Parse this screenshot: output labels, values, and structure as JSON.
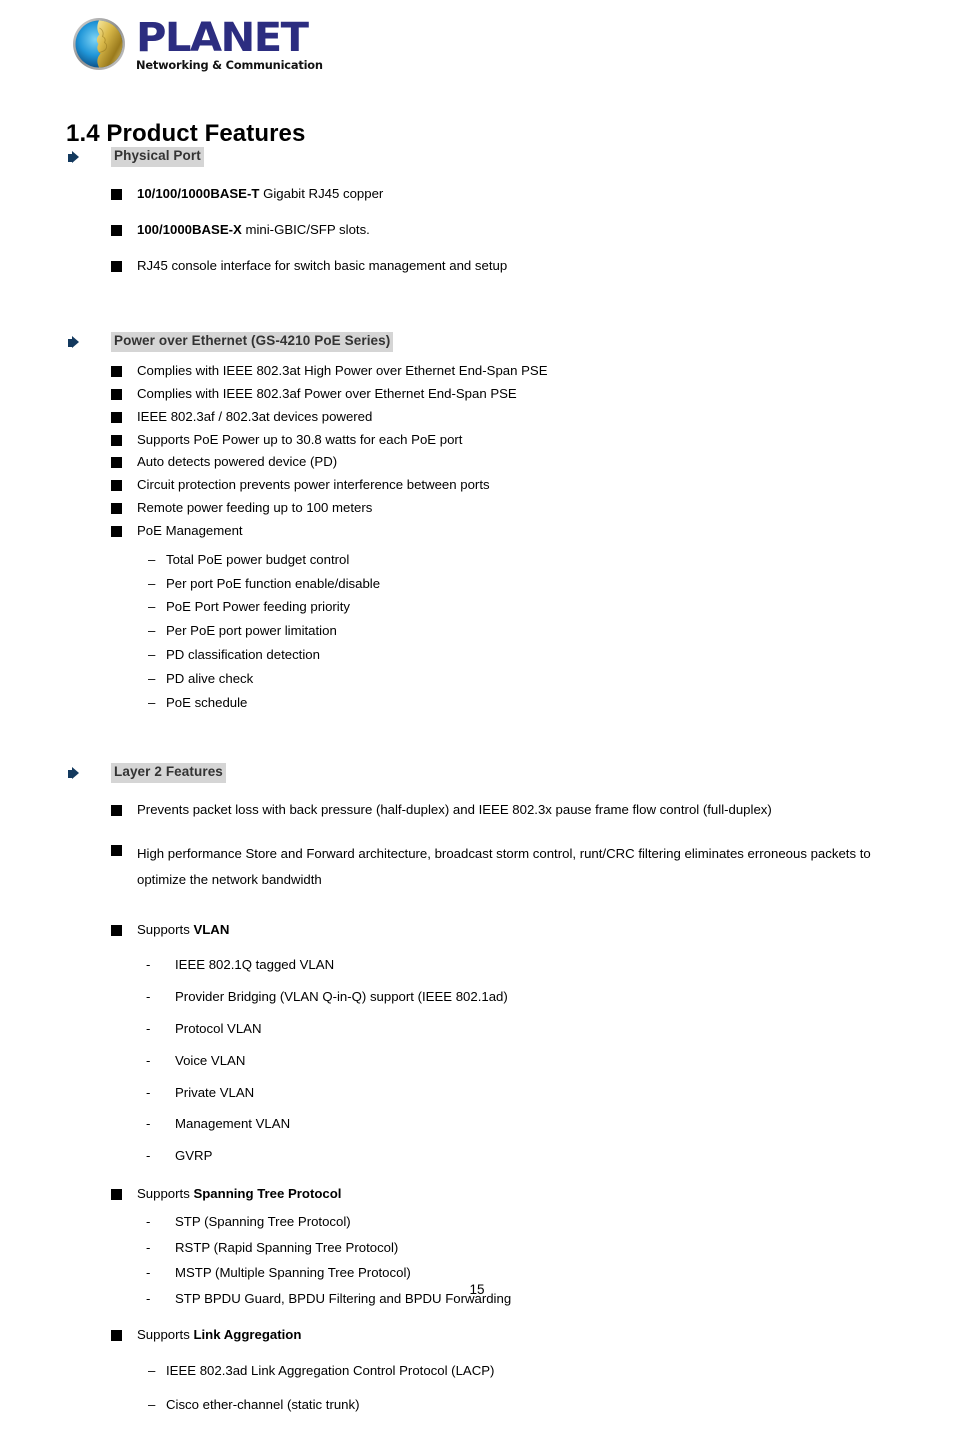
{
  "logo": {
    "brand": "PLANET",
    "tagline": "Networking & Communication",
    "globe_icon": "planet-globe-icon"
  },
  "title": "1.4 Product Features",
  "page_number": "15",
  "sections": [
    {
      "heading": "Physical Port",
      "items": [
        {
          "bold": "10/100/1000BASE-T",
          "rest": " Gigabit RJ45 copper"
        },
        {
          "bold": "100/1000BASE-X",
          "rest": " mini-GBIC/SFP slots."
        },
        {
          "bold": "",
          "rest": "RJ45 console interface for switch basic management and setup"
        }
      ]
    },
    {
      "heading": "Power over Ethernet (GS-4210 PoE Series)",
      "items": [
        {
          "bold": "",
          "rest": "Complies with IEEE 802.3at High Power over Ethernet End-Span PSE"
        },
        {
          "bold": "",
          "rest": "Complies with IEEE 802.3af Power over Ethernet End-Span PSE"
        },
        {
          "bold": "",
          "rest": "IEEE 802.3af / 802.3at devices powered"
        },
        {
          "bold": "",
          "rest": "Supports PoE Power up to 30.8 watts for each PoE port"
        },
        {
          "bold": "",
          "rest": "Auto detects powered device (PD)"
        },
        {
          "bold": "",
          "rest": "Circuit protection prevents power interference between ports"
        },
        {
          "bold": "",
          "rest": "Remote power feeding up to 100 meters"
        },
        {
          "bold": "",
          "rest": "PoE Management"
        }
      ],
      "sub_items": [
        "Total PoE power budget control",
        "Per port PoE function enable/disable",
        "PoE Port Power feeding priority",
        "Per PoE port power limitation",
        "PD classification detection",
        "PD alive check",
        "PoE schedule"
      ]
    },
    {
      "heading": "Layer 2 Features",
      "items": [
        {
          "bold": "",
          "rest": "Prevents packet loss with back pressure (half-duplex) and IEEE 802.3x pause frame flow control (full-duplex)"
        },
        {
          "bold": "",
          "rest": "High performance Store and Forward architecture, broadcast storm control, runt/CRC filtering eliminates erroneous packets to optimize the network bandwidth"
        }
      ],
      "vlan": {
        "label_prefix": "Supports ",
        "label_bold": "VLAN",
        "items": [
          "IEEE 802.1Q tagged VLAN",
          "Provider Bridging (VLAN Q-in-Q) support (IEEE 802.1ad)",
          "Protocol VLAN",
          "Voice VLAN",
          "Private VLAN",
          "Management VLAN",
          "GVRP"
        ]
      },
      "stp": {
        "label_prefix": "Supports ",
        "label_bold": "Spanning Tree Protocol",
        "items": [
          "STP (Spanning Tree Protocol)",
          "RSTP (Rapid Spanning Tree Protocol)",
          "MSTP (Multiple Spanning Tree Protocol)",
          "STP BPDU Guard, BPDU Filtering and BPDU Forwarding"
        ]
      },
      "lag": {
        "label_prefix": "Supports ",
        "label_bold": "Link Aggregation",
        "items": [
          "IEEE 802.3ad Link Aggregation Control Protocol (LACP)",
          "Cisco ether-channel (static trunk)"
        ]
      }
    }
  ],
  "markers": {
    "dash": "–",
    "hyphen": "-"
  },
  "colors": {
    "brand_blue": "#2c2d80",
    "marker_navy": "#13395e",
    "heading_highlight": "#d5d5d5",
    "heading_text": "#333333"
  }
}
